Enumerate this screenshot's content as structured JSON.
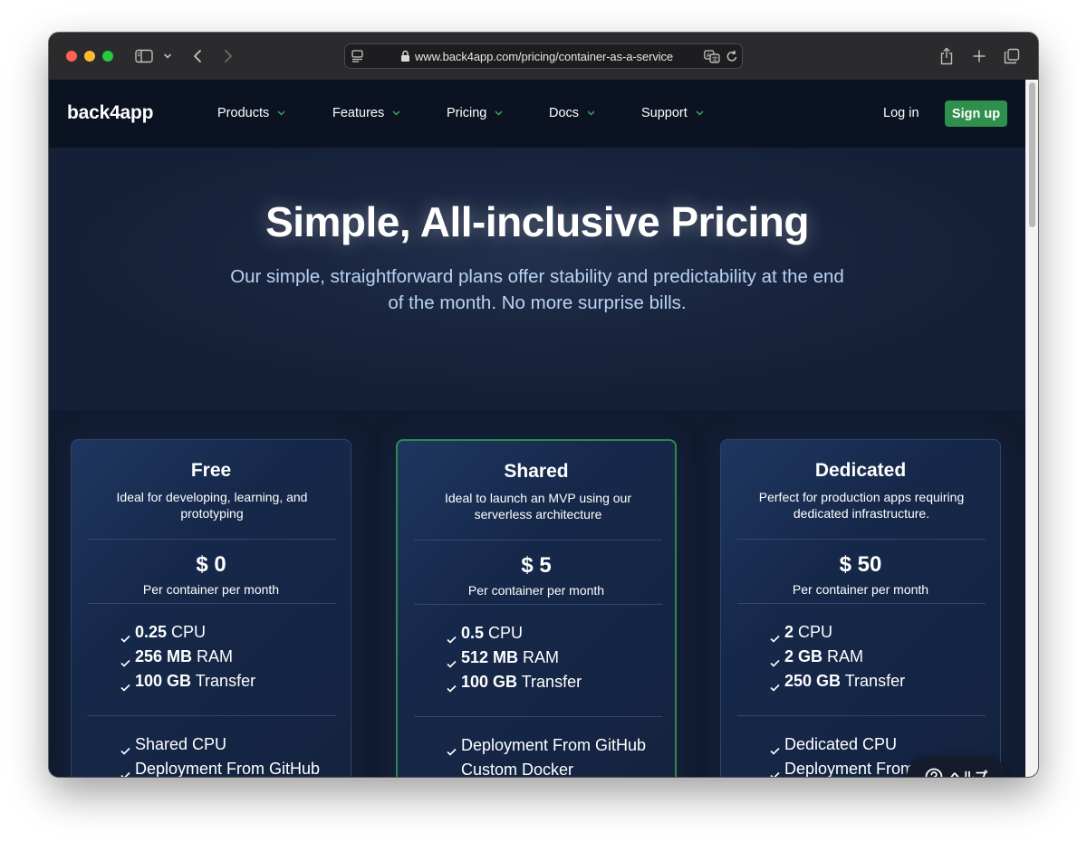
{
  "browser": {
    "url": "www.back4app.com/pricing/container-as-a-service"
  },
  "nav": {
    "logo": "back4app",
    "items": [
      {
        "label": "Products"
      },
      {
        "label": "Features"
      },
      {
        "label": "Pricing"
      },
      {
        "label": "Docs"
      },
      {
        "label": "Support"
      }
    ],
    "login": "Log in",
    "signup": "Sign up"
  },
  "hero": {
    "title": "Simple, All-inclusive Pricing",
    "subtitle": "Our simple, straightforward plans offer stability and predictability at the end of the month. No more surprise bills."
  },
  "plans": [
    {
      "name": "Free",
      "description": "Ideal for developing, learning, and prototyping",
      "price": "$ 0",
      "per": "Per container per month",
      "specs": [
        {
          "value": "0.25",
          "unit": " CPU"
        },
        {
          "value": "256 MB",
          "unit": " RAM"
        },
        {
          "value": "100 GB",
          "unit": " Transfer"
        }
      ],
      "features": [
        "Shared CPU",
        "Deployment From GitHub"
      ]
    },
    {
      "name": "Shared",
      "description": "Ideal to launch an MVP using our serverless architecture",
      "price": "$ 5",
      "per": "Per container per month",
      "specs": [
        {
          "value": "0.5",
          "unit": " CPU"
        },
        {
          "value": "512 MB",
          "unit": " RAM"
        },
        {
          "value": "100 GB",
          "unit": " Transfer"
        }
      ],
      "features": [
        "Deployment From GitHub",
        "Custom Docker"
      ]
    },
    {
      "name": "Dedicated",
      "description": "Perfect for production apps requiring dedicated infrastructure.",
      "price": "$ 50",
      "per": "Per container per month",
      "specs": [
        {
          "value": "2",
          "unit": " CPU"
        },
        {
          "value": "2 GB",
          "unit": " RAM"
        },
        {
          "value": "250 GB",
          "unit": " Transfer"
        }
      ],
      "features": [
        "Dedicated CPU",
        "Deployment From GitHub"
      ]
    }
  ],
  "help": {
    "label": "ヘルプ"
  },
  "colors": {
    "accent_green": "#2f8f4c",
    "nav_bg": "#0b1222",
    "hero_subtitle": "#b9d2f5"
  }
}
